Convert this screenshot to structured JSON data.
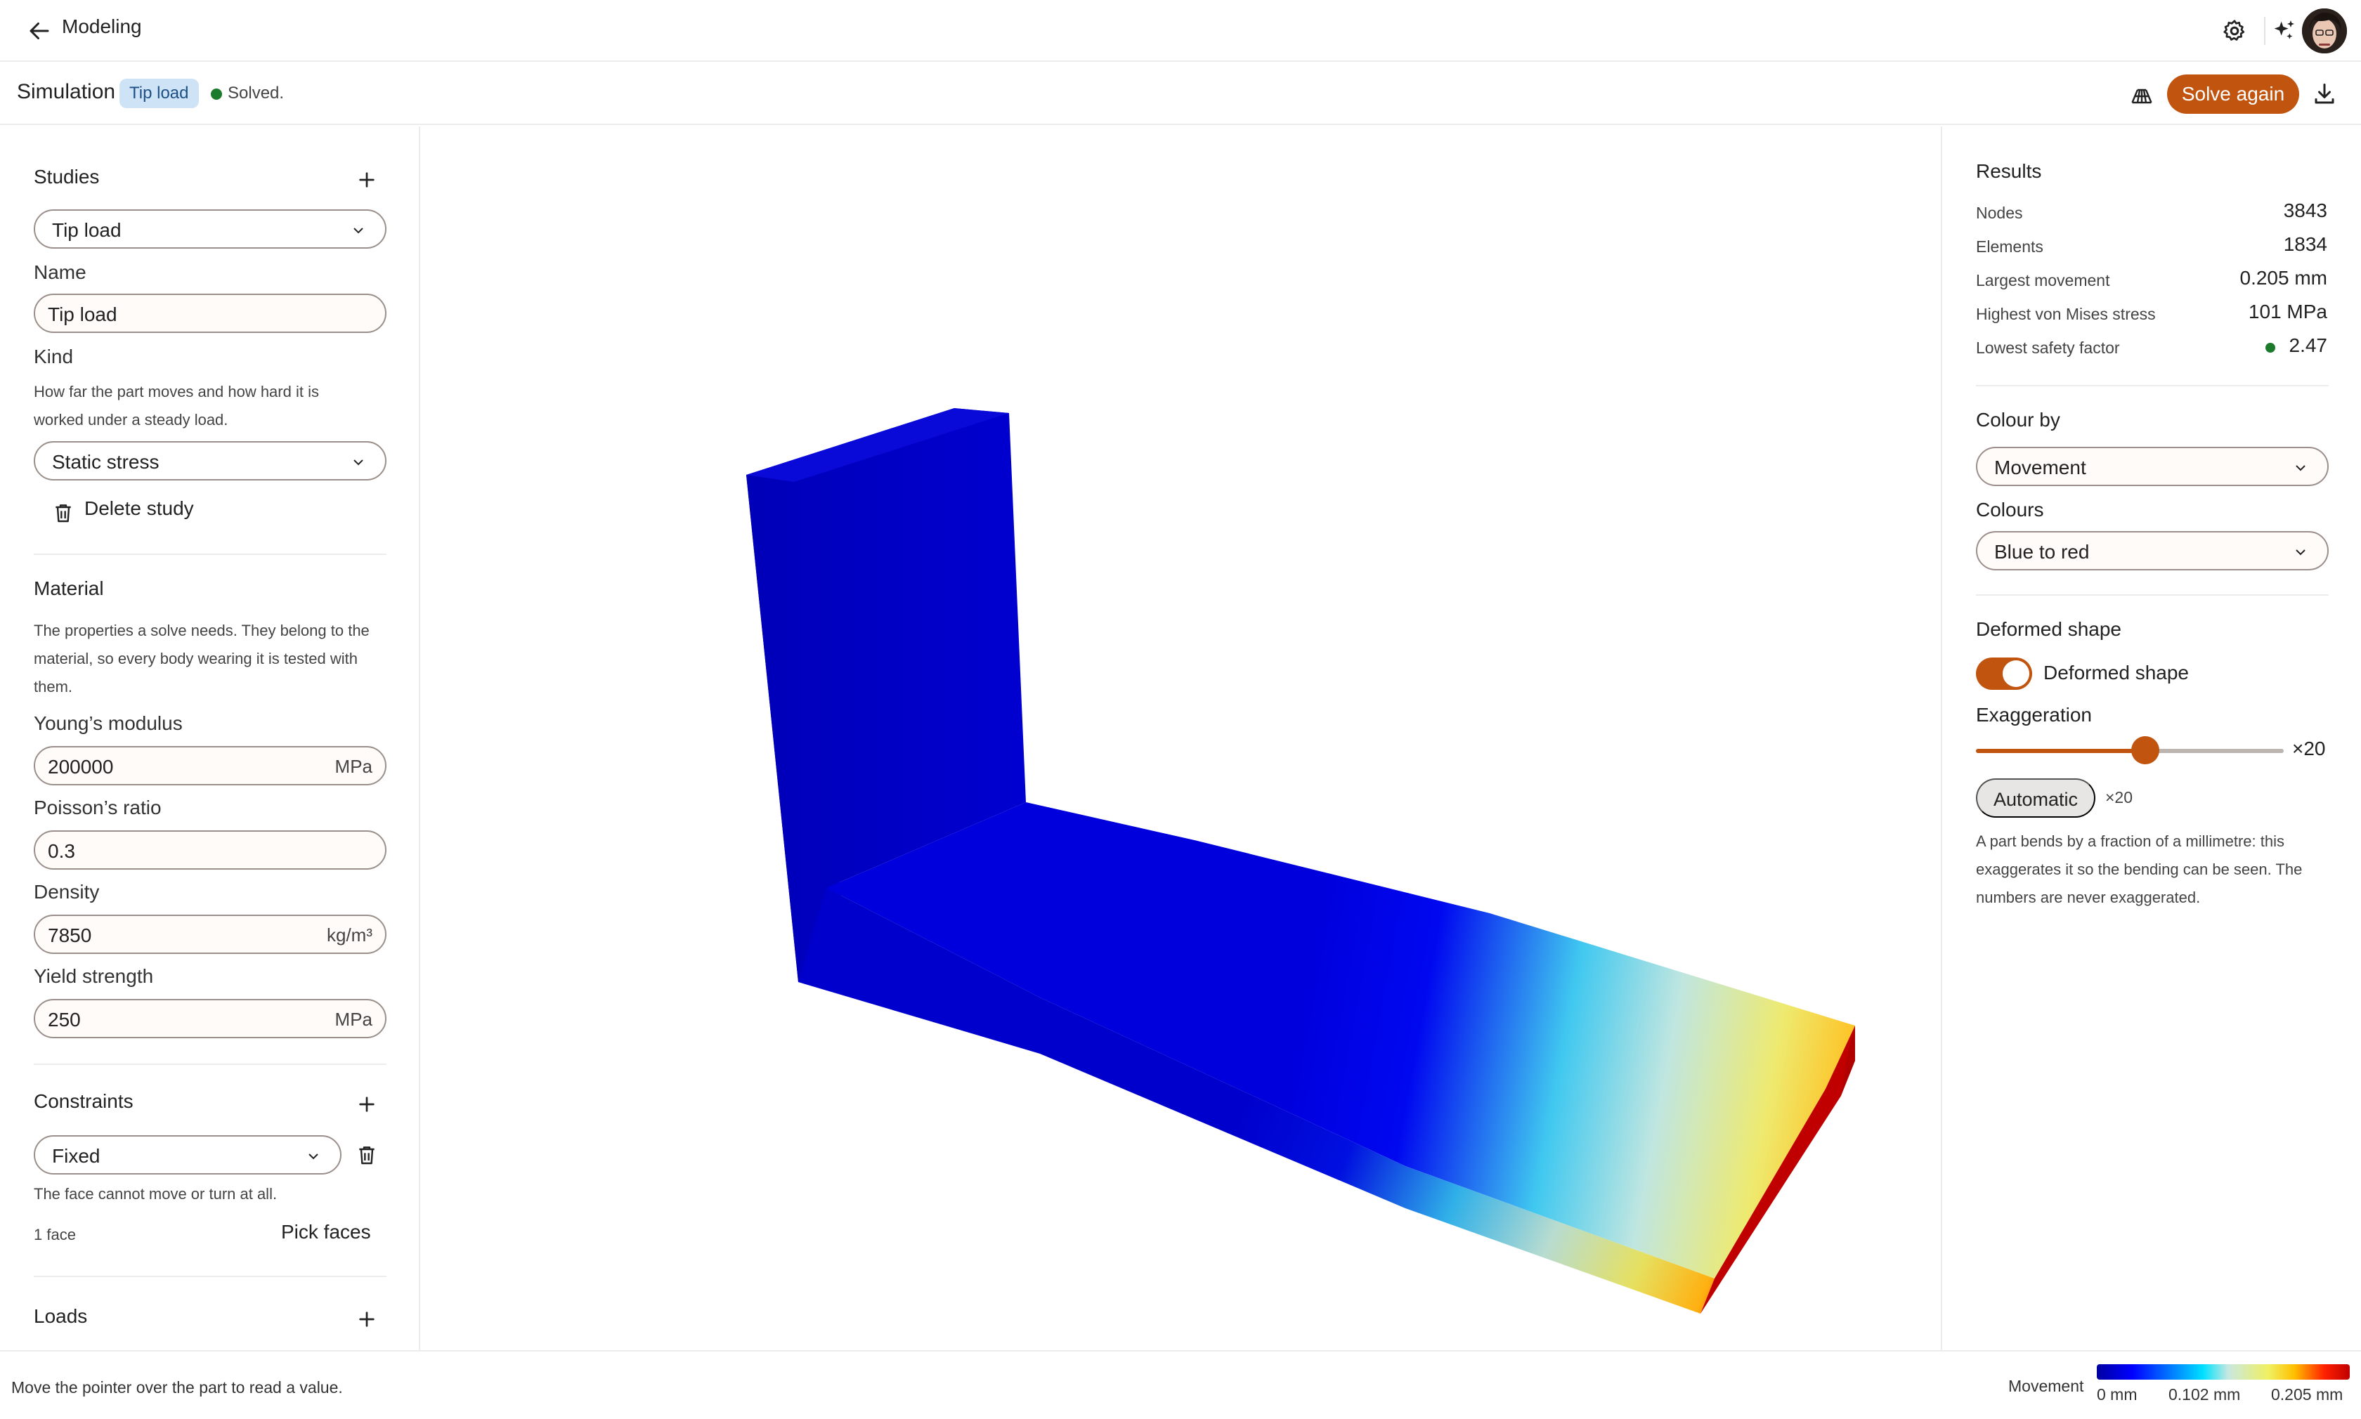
{
  "header": {
    "back_label": "Modeling"
  },
  "subheader": {
    "title": "Simulation",
    "study_badge": "Tip load",
    "status": "Solved.",
    "status_color": "#1b7a2c",
    "solve_button": "Solve again",
    "accent_color": "#c1540f"
  },
  "left": {
    "studies": {
      "title": "Studies",
      "selected": "Tip load",
      "name_label": "Name",
      "name_value": "Tip load",
      "kind_label": "Kind",
      "kind_help": "How far the part moves and how hard it is worked under a steady load.",
      "kind_value": "Static stress",
      "delete_label": "Delete study"
    },
    "material": {
      "title": "Material",
      "help": "The properties a solve needs. They belong to the material, so every body wearing it is tested with them.",
      "youngs_label": "Young’s modulus",
      "youngs_value": "200000",
      "youngs_unit": "MPa",
      "poisson_label": "Poisson’s ratio",
      "poisson_value": "0.3",
      "density_label": "Density",
      "density_value": "7850",
      "density_unit": "kg/m³",
      "yield_label": "Yield strength",
      "yield_value": "250",
      "yield_unit": "MPa"
    },
    "constraints": {
      "title": "Constraints",
      "type": "Fixed",
      "help": "The face cannot move or turn at all.",
      "count": "1 face",
      "pick_label": "Pick faces"
    },
    "loads": {
      "title": "Loads"
    }
  },
  "results": {
    "title": "Results",
    "nodes_label": "Nodes",
    "nodes_value": "3843",
    "elements_label": "Elements",
    "elements_value": "1834",
    "movement_label": "Largest movement",
    "movement_value": "0.205 mm",
    "stress_label": "Highest von Mises stress",
    "stress_value": "101 MPa",
    "safety_label": "Lowest safety factor",
    "safety_value": "2.47"
  },
  "display": {
    "colour_by_label": "Colour by",
    "colour_by_value": "Movement",
    "colours_label": "Colours",
    "colours_value": "Blue to red"
  },
  "deformed": {
    "title": "Deformed shape",
    "toggle_label": "Deformed shape",
    "toggle_on": true,
    "exaggeration_label": "Exaggeration",
    "exaggeration_value": "×20",
    "slider_fraction": 0.55,
    "auto_label": "Automatic",
    "auto_value": "×20",
    "help": "A part bends by a fraction of a millimetre: this exaggerates it so the bending can be seen. The numbers are never exaggerated."
  },
  "footer": {
    "hint": "Move the pointer over the part to read a value.",
    "legend_title": "Movement",
    "legend_min": "0 mm",
    "legend_mid": "0.102 mm",
    "legend_max": "0.205 mm"
  }
}
